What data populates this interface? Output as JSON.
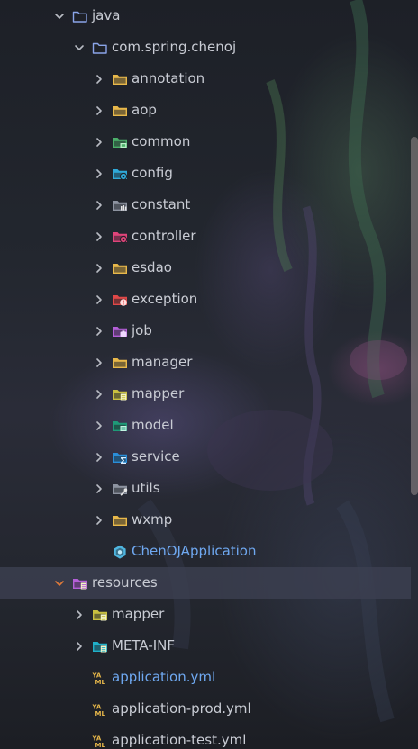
{
  "tree": {
    "items": [
      {
        "label": "java",
        "depth": 0,
        "expanded": true,
        "icon": "folder-icon",
        "color": "#8aa4e8"
      },
      {
        "label": "com.spring.chenoj",
        "depth": 1,
        "expanded": true,
        "icon": "package-folder-icon",
        "color": "#8aa4e8"
      },
      {
        "label": "annotation",
        "depth": 2,
        "expanded": false,
        "icon": "folder-icon",
        "color": "#e8b84a"
      },
      {
        "label": "aop",
        "depth": 2,
        "expanded": false,
        "icon": "folder-icon",
        "color": "#e8b84a"
      },
      {
        "label": "common",
        "depth": 2,
        "expanded": false,
        "icon": "folder-common-icon",
        "color": "#4caf6a"
      },
      {
        "label": "config",
        "depth": 2,
        "expanded": false,
        "icon": "folder-config-icon",
        "color": "#2fa9d8"
      },
      {
        "label": "constant",
        "depth": 2,
        "expanded": false,
        "icon": "folder-constant-icon",
        "color": "#8d93a0"
      },
      {
        "label": "controller",
        "depth": 2,
        "expanded": false,
        "icon": "folder-controller-icon",
        "color": "#e0447a"
      },
      {
        "label": "esdao",
        "depth": 2,
        "expanded": false,
        "icon": "folder-icon",
        "color": "#e8b84a"
      },
      {
        "label": "exception",
        "depth": 2,
        "expanded": false,
        "icon": "folder-exception-icon",
        "color": "#e04848"
      },
      {
        "label": "job",
        "depth": 2,
        "expanded": false,
        "icon": "folder-job-icon",
        "color": "#b45fd8"
      },
      {
        "label": "manager",
        "depth": 2,
        "expanded": false,
        "icon": "folder-icon",
        "color": "#e8b84a"
      },
      {
        "label": "mapper",
        "depth": 2,
        "expanded": false,
        "icon": "folder-mapper-icon",
        "color": "#c8c040"
      },
      {
        "label": "model",
        "depth": 2,
        "expanded": false,
        "icon": "folder-model-icon",
        "color": "#1f9a78"
      },
      {
        "label": "service",
        "depth": 2,
        "expanded": false,
        "icon": "folder-service-icon",
        "color": "#2a8ed8"
      },
      {
        "label": "utils",
        "depth": 2,
        "expanded": false,
        "icon": "folder-utils-icon",
        "color": "#8d93a0"
      },
      {
        "label": "wxmp",
        "depth": 2,
        "expanded": false,
        "icon": "folder-icon",
        "color": "#e8b84a"
      },
      {
        "label": "ChenOJApplication",
        "depth": 2,
        "expanded": null,
        "icon": "spring-boot-application-icon",
        "color": "#4fb6e0",
        "text_color": "#6fa8f0"
      },
      {
        "label": "resources",
        "depth": 0,
        "expanded": true,
        "icon": "folder-resources-icon",
        "color": "#b45fd8",
        "selected": true,
        "chevron_color": "#e07a3a"
      },
      {
        "label": "mapper",
        "depth": 1,
        "expanded": false,
        "icon": "folder-mapper-icon",
        "color": "#c8c040"
      },
      {
        "label": "META-INF",
        "depth": 1,
        "expanded": false,
        "icon": "folder-meta-inf-icon",
        "color": "#20b0c8"
      },
      {
        "label": "application.yml",
        "depth": 1,
        "expanded": null,
        "icon": "yaml-file-icon",
        "color": "#e8b84a",
        "text_color": "#6fa8f0"
      },
      {
        "label": "application-prod.yml",
        "depth": 1,
        "expanded": null,
        "icon": "yaml-file-icon",
        "color": "#e8b84a"
      },
      {
        "label": "application-test.yml",
        "depth": 1,
        "expanded": null,
        "icon": "yaml-file-icon",
        "color": "#e8b84a"
      }
    ]
  }
}
